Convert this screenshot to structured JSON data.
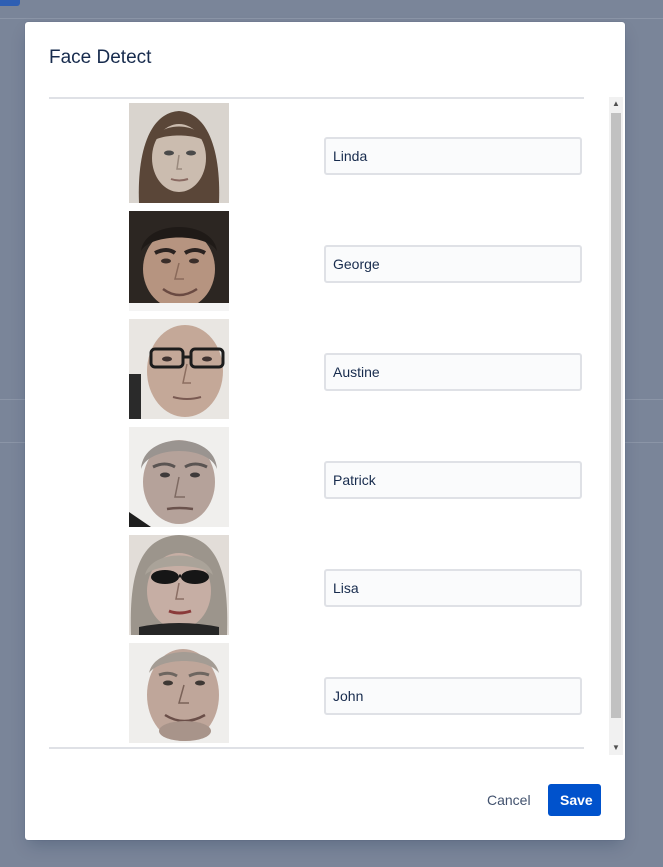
{
  "modal": {
    "title": "Face Detect",
    "cancel_label": "Cancel",
    "save_label": "Save"
  },
  "faces": [
    {
      "name": "Linda",
      "icon": "face-thumbnail-icon"
    },
    {
      "name": "George",
      "icon": "face-thumbnail-icon"
    },
    {
      "name": "Austine",
      "icon": "face-thumbnail-icon"
    },
    {
      "name": "Patrick",
      "icon": "face-thumbnail-icon"
    },
    {
      "name": "Lisa",
      "icon": "face-thumbnail-icon"
    },
    {
      "name": "John",
      "icon": "face-thumbnail-icon"
    }
  ],
  "colors": {
    "primary": "#0052cc",
    "overlay": "#7a8599",
    "title": "#172b4d"
  }
}
